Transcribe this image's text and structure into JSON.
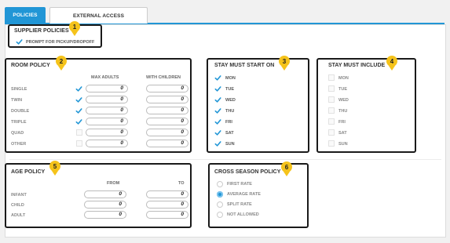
{
  "tabs": [
    {
      "label": "POLICIES",
      "active": true
    },
    {
      "label": "EXTERNAL ACCESS",
      "active": false
    }
  ],
  "supplier_policies": {
    "title": "SUPPLIER POLICIES",
    "prompt_label": "PROMPT FOR PICKUP/DROPOFF",
    "prompt_checked": true
  },
  "room_policy": {
    "title": "ROOM POLICY",
    "col_max_adults": "MAX ADULTS",
    "col_with_children": "WITH CHILDREN",
    "rows": [
      {
        "label": "SINGLE",
        "checked": true,
        "max_adults": "0",
        "with_children": "0"
      },
      {
        "label": "TWIN",
        "checked": true,
        "max_adults": "0",
        "with_children": "0"
      },
      {
        "label": "DOUBLE",
        "checked": true,
        "max_adults": "0",
        "with_children": "0"
      },
      {
        "label": "TRIPLE",
        "checked": true,
        "max_adults": "0",
        "with_children": "0"
      },
      {
        "label": "QUAD",
        "checked": false,
        "max_adults": "0",
        "with_children": "0"
      },
      {
        "label": "OTHER",
        "checked": false,
        "max_adults": "0",
        "with_children": "0"
      }
    ]
  },
  "stay_must_start_on": {
    "title": "STAY MUST START ON",
    "days": [
      {
        "label": "MON",
        "checked": true
      },
      {
        "label": "TUE",
        "checked": true
      },
      {
        "label": "WED",
        "checked": true
      },
      {
        "label": "THU",
        "checked": true
      },
      {
        "label": "FRI",
        "checked": true
      },
      {
        "label": "SAT",
        "checked": true
      },
      {
        "label": "SUN",
        "checked": true
      }
    ]
  },
  "stay_must_include": {
    "title": "STAY MUST INCLUDE",
    "days": [
      {
        "label": "MON",
        "checked": false
      },
      {
        "label": "TUE",
        "checked": false
      },
      {
        "label": "WED",
        "checked": false
      },
      {
        "label": "THU",
        "checked": false
      },
      {
        "label": "FRI",
        "checked": false
      },
      {
        "label": "SAT",
        "checked": false
      },
      {
        "label": "SUN",
        "checked": false
      }
    ]
  },
  "age_policy": {
    "title": "AGE POLICY",
    "col_from": "FROM",
    "col_to": "TO",
    "rows": [
      {
        "label": "INFANT",
        "from": "0",
        "to": "0"
      },
      {
        "label": "CHILD",
        "from": "0",
        "to": "0"
      },
      {
        "label": "ADULT",
        "from": "0",
        "to": "0"
      }
    ]
  },
  "cross_season_policy": {
    "title": "CROSS SEASON POLICY",
    "options": [
      {
        "label": "FIRST RATE",
        "selected": false
      },
      {
        "label": "AVERAGE RATE",
        "selected": true
      },
      {
        "label": "SPLIT RATE",
        "selected": false
      },
      {
        "label": "NOT ALLOWED",
        "selected": false
      }
    ]
  },
  "badges": [
    "1",
    "2",
    "3",
    "4",
    "5",
    "6"
  ],
  "colors": {
    "accent": "#2196d6",
    "badge": "#f5c31b",
    "highlight_border": "#1a1a1a"
  }
}
